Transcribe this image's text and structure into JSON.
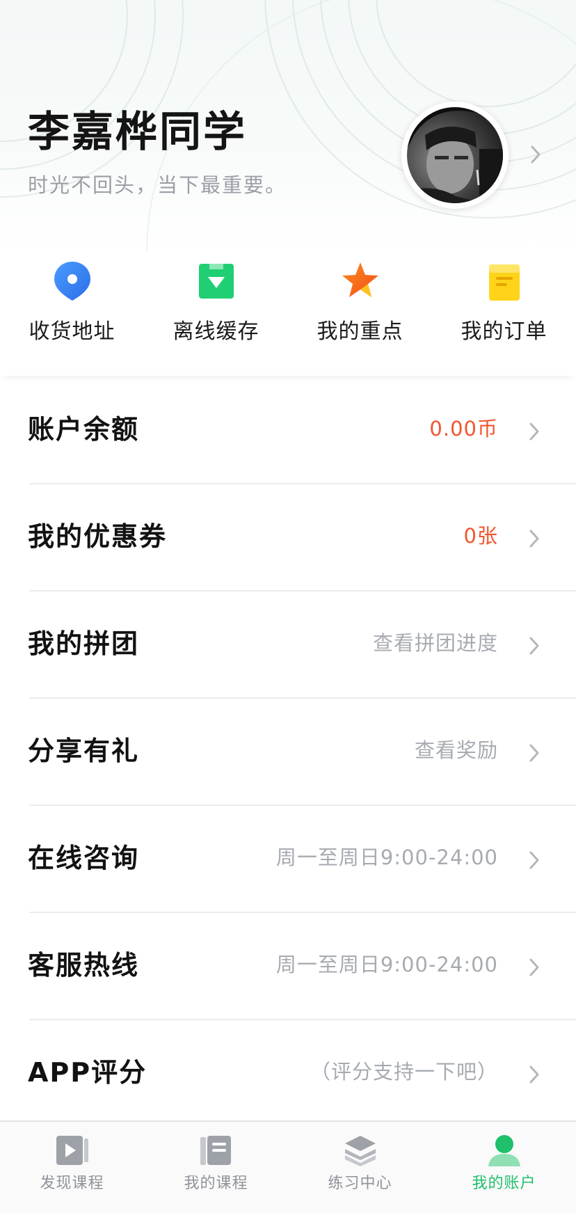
{
  "profile": {
    "name": "李嘉桦同学",
    "motto": "时光不回头，当下最重要。"
  },
  "quick_actions": [
    {
      "label": "收货地址",
      "icon": "location-pin-icon"
    },
    {
      "label": "离线缓存",
      "icon": "download-box-icon"
    },
    {
      "label": "我的重点",
      "icon": "star-icon"
    },
    {
      "label": "我的订单",
      "icon": "order-clipboard-icon"
    }
  ],
  "menu": [
    {
      "title": "账户余额",
      "value": "0.00币",
      "accent": true
    },
    {
      "title": "我的优惠券",
      "value": "0张",
      "accent": true
    },
    {
      "title": "我的拼团",
      "value": "查看拼团进度",
      "accent": false
    },
    {
      "title": "分享有礼",
      "value": "查看奖励",
      "accent": false
    },
    {
      "title": "在线咨询",
      "value": "周一至周日9:00-24:00",
      "accent": false
    },
    {
      "title": "客服热线",
      "value": "周一至周日9:00-24:00",
      "accent": false
    },
    {
      "title": "APP评分",
      "value": "（评分支持一下吧）",
      "accent": false
    }
  ],
  "tabbar": {
    "tabs": [
      {
        "label": "发现课程",
        "icon": "play-video-icon",
        "active": false
      },
      {
        "label": "我的课程",
        "icon": "book-icon",
        "active": false
      },
      {
        "label": "练习中心",
        "icon": "layers-icon",
        "active": false
      },
      {
        "label": "我的账户",
        "icon": "user-icon",
        "active": true
      }
    ]
  },
  "colors": {
    "accent_orange": "#f0562e",
    "active_green": "#1fbf6b",
    "muted_gray": "#a7abb1"
  }
}
